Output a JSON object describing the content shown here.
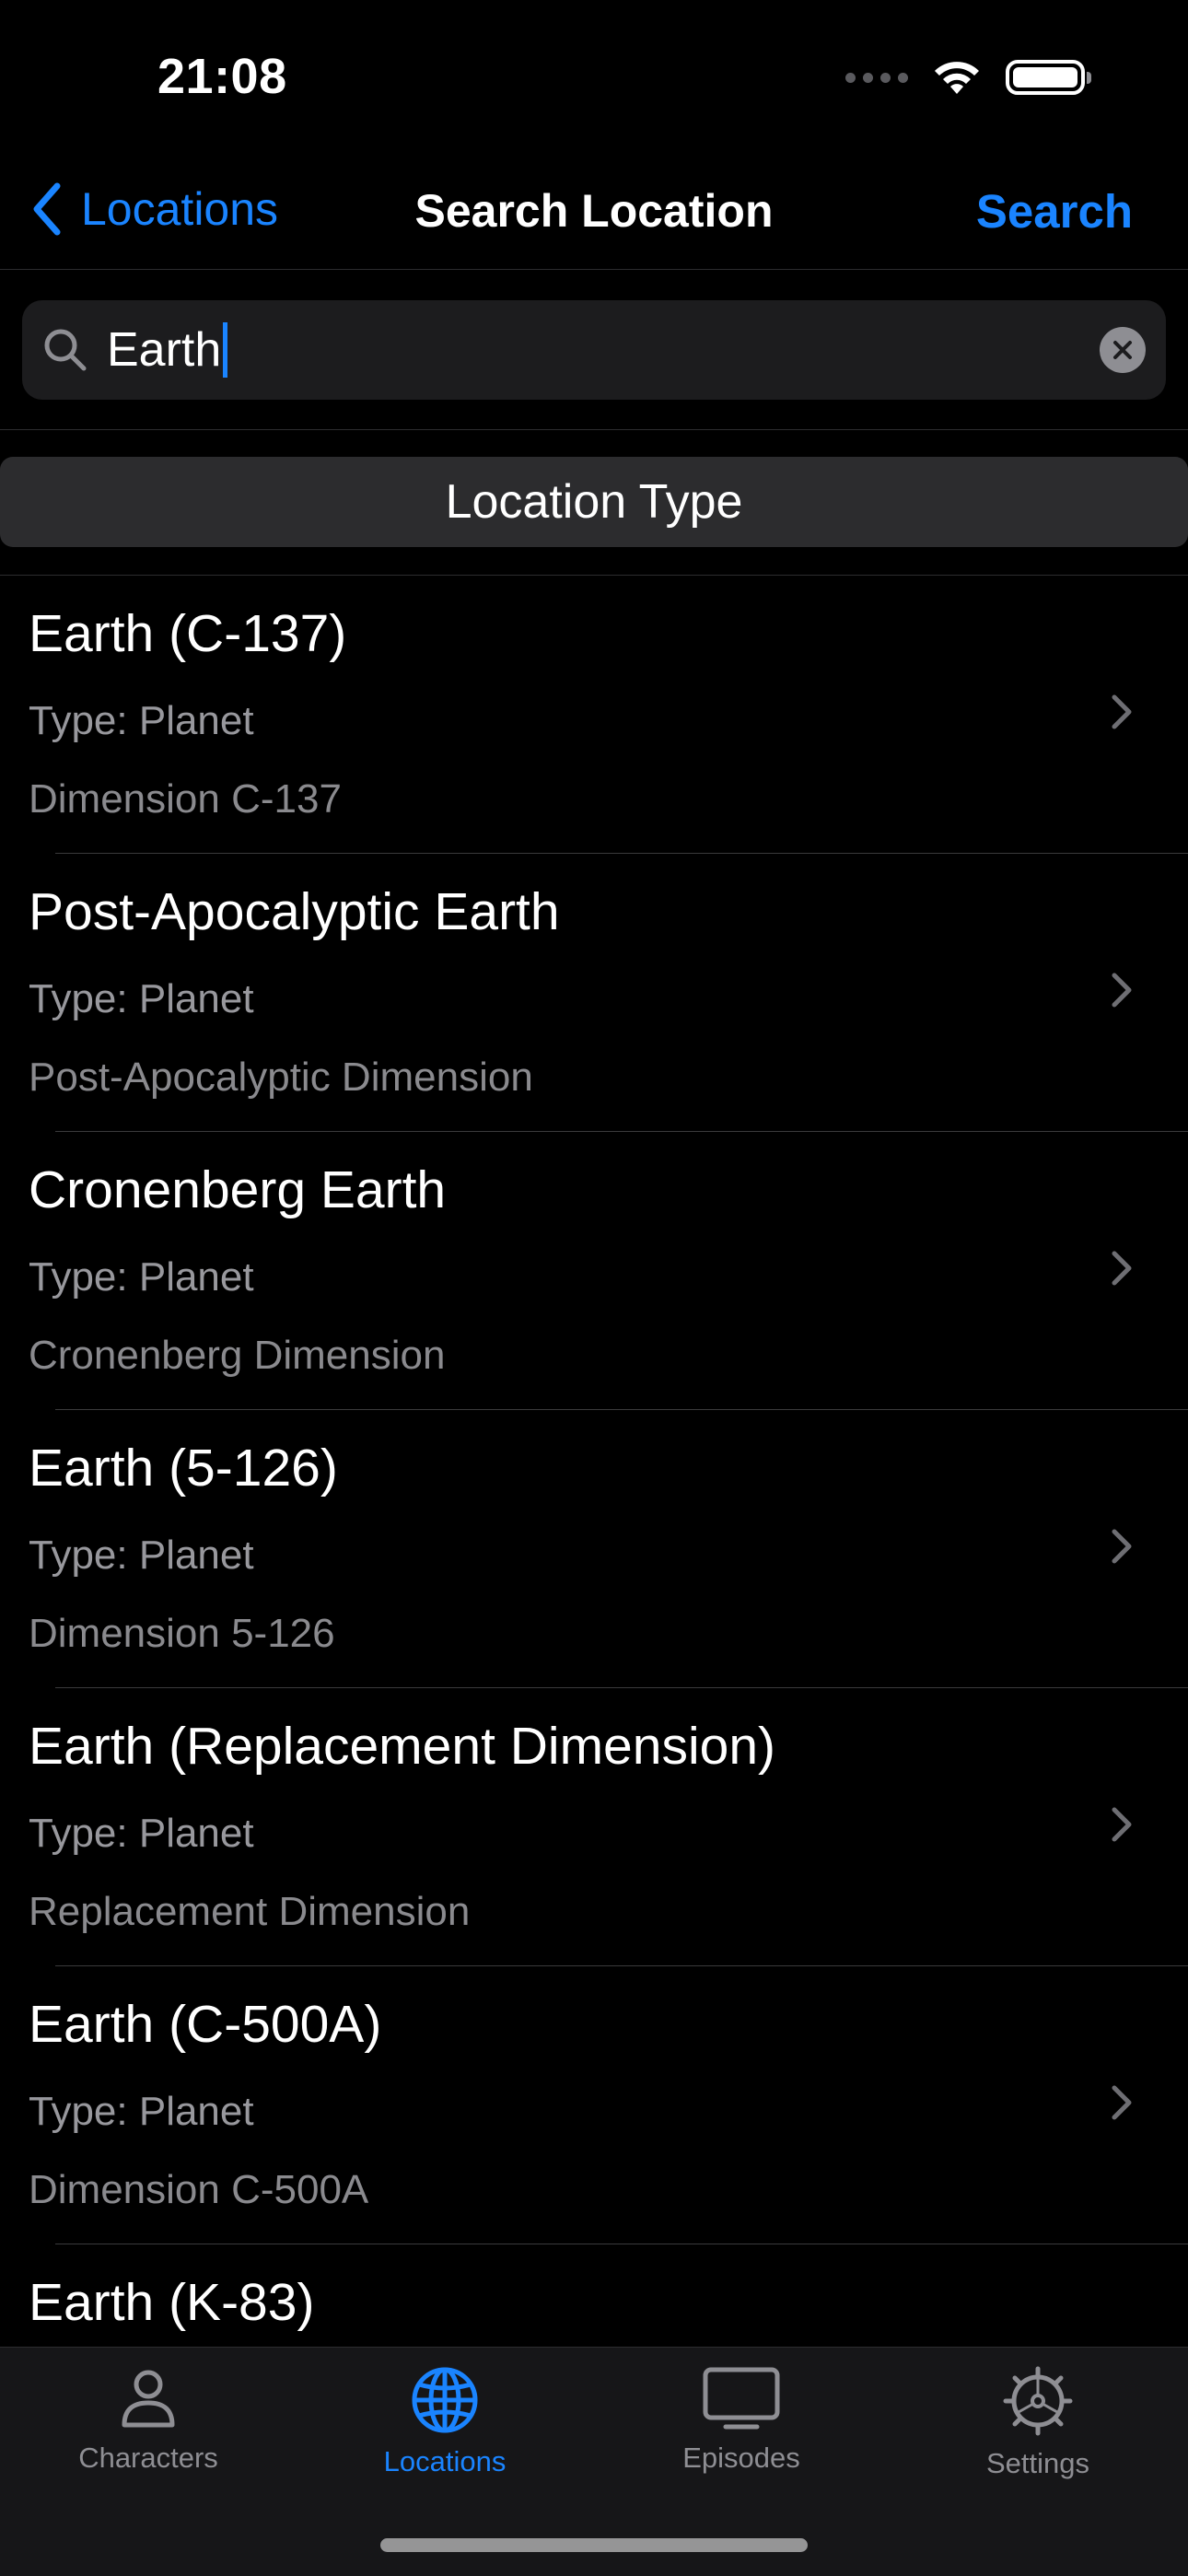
{
  "status_bar": {
    "time": "21:08"
  },
  "nav": {
    "back_label": "Locations",
    "title": "Search Location",
    "action_label": "Search"
  },
  "search": {
    "value": "Earth",
    "placeholder": ""
  },
  "filter": {
    "type_button_label": "Location Type"
  },
  "locations": [
    {
      "name": "Earth (C-137)",
      "type": "Type: Planet",
      "dimension": "Dimension C-137"
    },
    {
      "name": "Post-Apocalyptic Earth",
      "type": "Type: Planet",
      "dimension": "Post-Apocalyptic Dimension"
    },
    {
      "name": "Cronenberg Earth",
      "type": "Type: Planet",
      "dimension": "Cronenberg Dimension"
    },
    {
      "name": "Earth (5-126)",
      "type": "Type: Planet",
      "dimension": "Dimension 5-126"
    },
    {
      "name": "Earth (Replacement Dimension)",
      "type": "Type: Planet",
      "dimension": "Replacement Dimension"
    },
    {
      "name": "Earth (C-500A)",
      "type": "Type: Planet",
      "dimension": "Dimension C-500A"
    },
    {
      "name": "Earth (K-83)",
      "type": "",
      "dimension": ""
    }
  ],
  "tabs": [
    {
      "label": "Characters",
      "icon": "person-icon",
      "active": false
    },
    {
      "label": "Locations",
      "icon": "globe-icon",
      "active": true
    },
    {
      "label": "Episodes",
      "icon": "tv-icon",
      "active": false
    },
    {
      "label": "Settings",
      "icon": "gear-icon",
      "active": false
    }
  ],
  "colors": {
    "accent": "#1a84ff",
    "background": "#000000",
    "secondary_text": "#98989d",
    "tab_bar": "#161618"
  }
}
